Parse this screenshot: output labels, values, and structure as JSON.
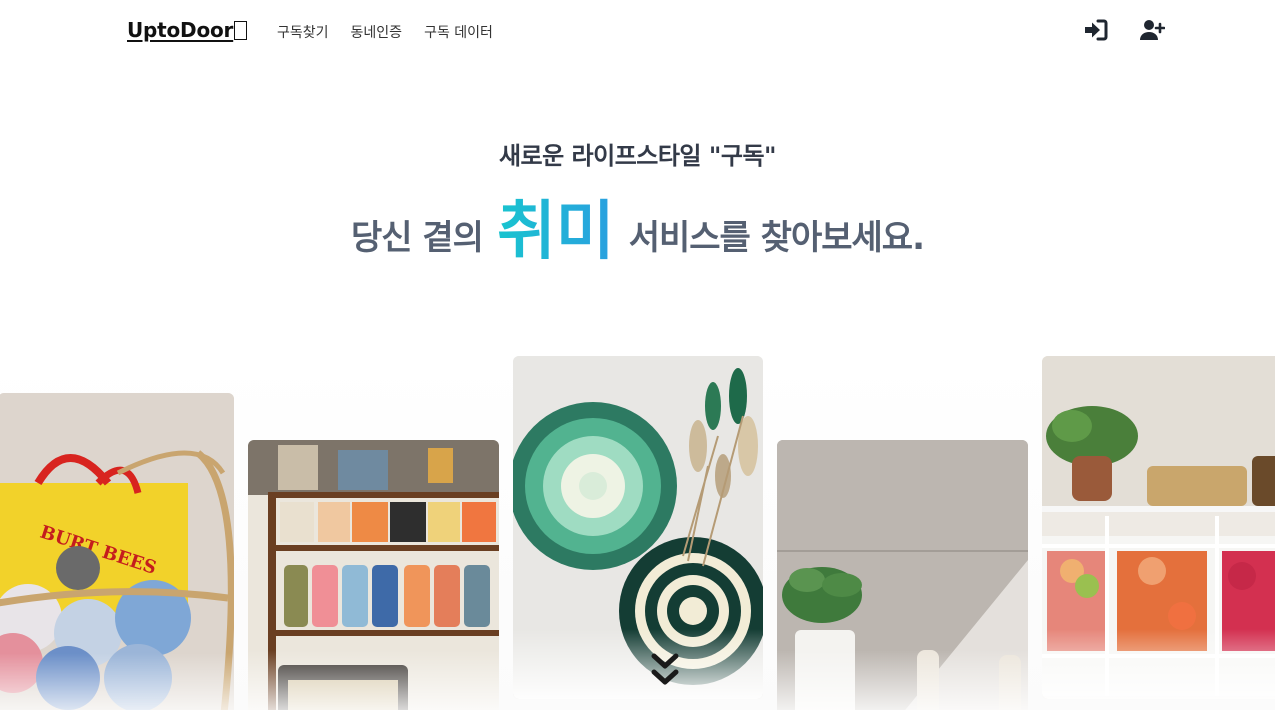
{
  "nav": {
    "logo": "UptoDoor",
    "menu": [
      {
        "label": "구독찾기"
      },
      {
        "label": "동네인증"
      },
      {
        "label": "구독 데이터"
      }
    ],
    "icons": [
      "sign-in-icon",
      "user-plus-icon"
    ]
  },
  "hero": {
    "subtitle": "새로운 라이프스타일 \"구독\"",
    "line_prefix": "당신 곁의",
    "highlight": "취미",
    "line_suffix": "서비스를 찾아보세요."
  },
  "cards": [
    {
      "name": "knit-basket-photo"
    },
    {
      "name": "yarn-shelf-photo"
    },
    {
      "name": "macrame-coasters-photo"
    },
    {
      "name": "plant-vase-photo"
    },
    {
      "name": "yarn-cart-photo"
    }
  ],
  "colors": {
    "accent_start": "#19c4cf",
    "accent_end": "#2a9fe0",
    "text_dark": "#333a48",
    "text_mid": "#556072"
  }
}
